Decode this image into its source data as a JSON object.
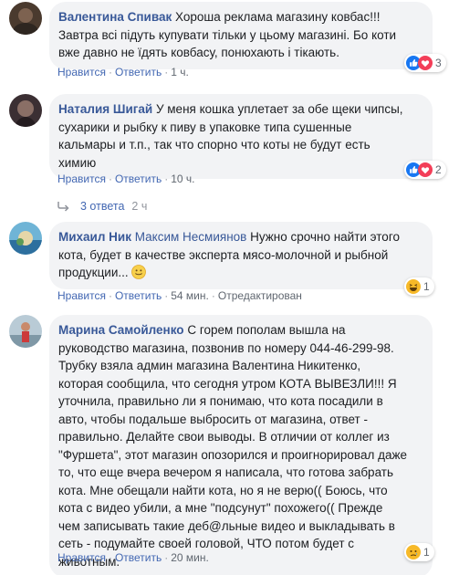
{
  "comments": [
    {
      "author": "Валентина Спивак",
      "lines": [
        "Хорошa реклама магазину ковбас!!!",
        "Завтра всі підуть купувати тільки у цьому магазині. Бо коти",
        "вже давно не їдять ковбасу, понюхають і тікають."
      ],
      "like": "Нравится",
      "reply": "Ответить",
      "time": "1 ч.",
      "reaction_count": "3"
    },
    {
      "author": "Наталия Шигай",
      "lines": [
        "У меня кошка уплетает за обе щеки чипсы,",
        "сухарики и рыбку к пиву в упаковке типа сушенные",
        "кальмары и т.п., так что спорно что коты не будут есть",
        "химию"
      ],
      "like": "Нравится",
      "reply": "Ответить",
      "time": "10 ч.",
      "reaction_count": "2",
      "replies_label": "3 ответа",
      "replies_time": "2 ч"
    },
    {
      "author": "Михаил Ник",
      "mention": "Максим Несмиянов",
      "lines": [
        "Нужно срочно найти этого",
        "кота, будет в качестве эксперта мясо-молочной и рыбной",
        "продукции..."
      ],
      "like": "Нравится",
      "reply": "Ответить",
      "time": "54 мин.",
      "edited": "Отредактирован",
      "reaction_count": "1"
    },
    {
      "author": "Марина Самойленко",
      "lines": [
        "С горем пополам вышла на",
        "руководство магазина, позвонив по номеру 044-46-299-98.",
        "Трубку взяла админ магазина Валентина Никитенко,",
        "которая сообщила, что сегодня утром КОТА ВЫВЕЗЛИ!!! Я",
        "уточнила, правильно ли я понимаю, что кота посадили в",
        "авто, чтобы подальше выбросить от магазина, ответ -",
        "правильно. Делайте свои выводы. В отличии от коллег из",
        "\"Фуршета\", этот магазин опозорился и проигнорировал даже",
        "то, что еще вчера вечером я написала, что готова забрать",
        "кота. Мне обещали найти кота, но я не верю(( Боюсь, что",
        "кота с видео убили, а мне \"подсунут\" похожего(( Прежде",
        "чем записывать такие деб@льные видео и выкладывать в",
        "сеть - подумайте своей головой, ЧТО потом будет с",
        "животным."
      ],
      "like": "Нравится",
      "reply": "Ответить",
      "time": "20 мин.",
      "reaction_count": "1"
    }
  ],
  "icons": {
    "reaction_like_love": "like-love-icon",
    "reaction_haha": "haha-icon",
    "reaction_sad": "sad-icon",
    "reply_arrow": "reply-arrow-icon",
    "smile_emoji": "smile-emoji-icon"
  },
  "colors": {
    "author": "#385898",
    "link": "#4267b2",
    "bubble": "#f2f3f5",
    "like_blue": "#1877f2",
    "love_red": "#f33e58",
    "emoji_yellow": "#f7b928"
  }
}
